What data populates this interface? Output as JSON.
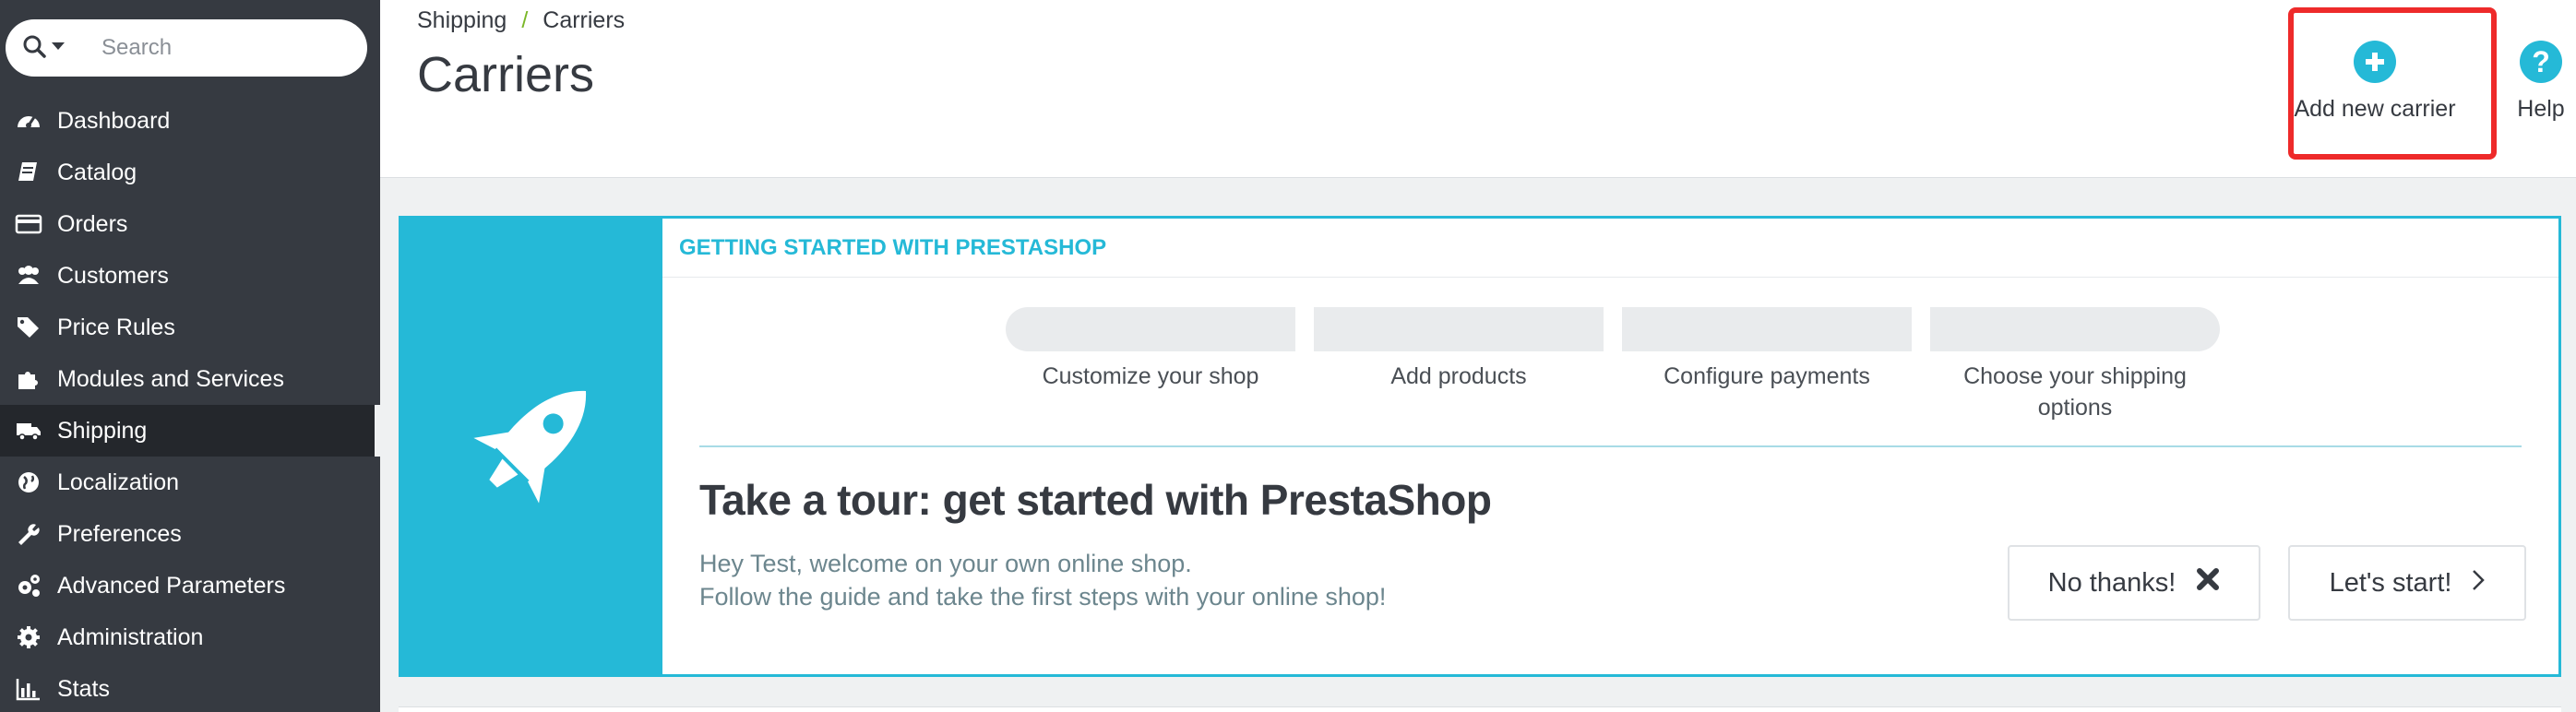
{
  "sidebar": {
    "search": {
      "placeholder": "Search"
    },
    "items": [
      {
        "label": "Dashboard",
        "icon": "dashboard-icon"
      },
      {
        "label": "Catalog",
        "icon": "book-icon"
      },
      {
        "label": "Orders",
        "icon": "credit-card-icon"
      },
      {
        "label": "Customers",
        "icon": "users-icon"
      },
      {
        "label": "Price Rules",
        "icon": "tags-icon"
      },
      {
        "label": "Modules and Services",
        "icon": "puzzle-icon"
      },
      {
        "label": "Shipping",
        "icon": "truck-icon",
        "active": true
      },
      {
        "label": "Localization",
        "icon": "globe-icon"
      },
      {
        "label": "Preferences",
        "icon": "wrench-icon"
      },
      {
        "label": "Advanced Parameters",
        "icon": "cogs-icon"
      },
      {
        "label": "Administration",
        "icon": "cog-icon"
      },
      {
        "label": "Stats",
        "icon": "bar-chart-icon"
      }
    ]
  },
  "header": {
    "breadcrumb": [
      "Shipping",
      "Carriers"
    ],
    "breadcrumb_separator": "/",
    "title": "Carriers",
    "toolbar": {
      "add_carrier_label": "Add new carrier",
      "add_carrier_icon": "plus-circle-icon",
      "help_label": "Help",
      "help_icon": "question-circle-icon"
    }
  },
  "onboarding": {
    "heading": "GETTING STARTED WITH PRESTASHOP",
    "steps": [
      "Customize your shop",
      "Add products",
      "Configure payments",
      "Choose your shipping options"
    ],
    "tour_title": "Take a tour: get started with PrestaShop",
    "text_line1": "Hey Test, welcome on your own online shop.",
    "text_line2": "Follow the guide and take the first steps with your online shop!",
    "no_thanks_label": "No thanks!",
    "lets_start_label": "Let's start!",
    "icon": "rocket-icon"
  },
  "colors": {
    "sidebar_bg": "#363a41",
    "accent": "#25b9d7",
    "highlight_box": "#ee2a2a"
  }
}
